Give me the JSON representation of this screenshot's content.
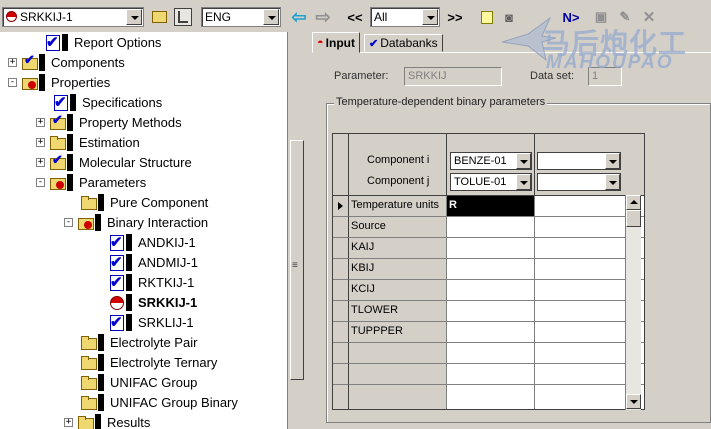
{
  "toolbar": {
    "form_selector": "SRKKIJ-1",
    "units": "ENG",
    "nav_back": "<<",
    "nav_forward": ">>",
    "filter": "All",
    "next_label": "N>"
  },
  "tree": {
    "items": [
      {
        "label": "Report Options",
        "icon": "check-icon",
        "expander": ""
      },
      {
        "label": "Components",
        "icon": "check-folder-icon",
        "expander": "+"
      },
      {
        "label": "Properties",
        "icon": "red-folder-icon",
        "expander": "-"
      },
      {
        "label": "Specifications",
        "icon": "check-icon",
        "expander": ""
      },
      {
        "label": "Property Methods",
        "icon": "check-folder-icon",
        "expander": "+"
      },
      {
        "label": "Estimation",
        "icon": "folder-icon",
        "expander": "+"
      },
      {
        "label": "Molecular Structure",
        "icon": "check-folder-icon",
        "expander": "+"
      },
      {
        "label": "Parameters",
        "icon": "red-folder-icon",
        "expander": "-"
      },
      {
        "label": "Pure Component",
        "icon": "folder-icon",
        "expander": ""
      },
      {
        "label": "Binary Interaction",
        "icon": "red-folder-icon",
        "expander": "-"
      },
      {
        "label": "ANDKIJ-1",
        "icon": "check-icon",
        "expander": ""
      },
      {
        "label": "ANDMIJ-1",
        "icon": "check-icon",
        "expander": ""
      },
      {
        "label": "RKTKIJ-1",
        "icon": "check-icon",
        "expander": ""
      },
      {
        "label": "SRKKIJ-1",
        "icon": "half-red-icon",
        "expander": ""
      },
      {
        "label": "SRKLIJ-1",
        "icon": "check-icon",
        "expander": ""
      },
      {
        "label": "Electrolyte Pair",
        "icon": "folder-icon",
        "expander": ""
      },
      {
        "label": "Electrolyte Ternary",
        "icon": "folder-icon",
        "expander": ""
      },
      {
        "label": "UNIFAC Group",
        "icon": "folder-icon",
        "expander": ""
      },
      {
        "label": "UNIFAC Group Binary",
        "icon": "folder-icon",
        "expander": ""
      },
      {
        "label": "Results",
        "icon": "folder-icon",
        "expander": "+"
      }
    ]
  },
  "tabs": [
    {
      "label": "Input",
      "active": true
    },
    {
      "label": "Databanks",
      "active": false
    }
  ],
  "form": {
    "parameter_label": "Parameter:",
    "parameter_value": "SRKKIJ",
    "dataset_label": "Data set:",
    "dataset_value": "1",
    "group_title": "Temperature-dependent binary parameters"
  },
  "grid": {
    "component_i_label": "Component  i",
    "component_j_label": "Component  j",
    "col1_component_i": "BENZE-01",
    "col1_component_j": "TOLUE-01",
    "col2_component_i": "",
    "col2_component_j": "",
    "rows": [
      {
        "label": "Temperature units",
        "col1": "R",
        "col2": ""
      },
      {
        "label": "Source",
        "col1": "",
        "col2": ""
      },
      {
        "label": "KAIJ",
        "col1": "",
        "col2": ""
      },
      {
        "label": "KBIJ",
        "col1": "",
        "col2": ""
      },
      {
        "label": "KCIJ",
        "col1": "",
        "col2": ""
      },
      {
        "label": "TLOWER",
        "col1": "",
        "col2": ""
      },
      {
        "label": "TUPPPER",
        "col1": "",
        "col2": ""
      },
      {
        "label": "",
        "col1": "",
        "col2": ""
      },
      {
        "label": "",
        "col1": "",
        "col2": ""
      },
      {
        "label": "",
        "col1": "",
        "col2": ""
      }
    ]
  },
  "watermark": {
    "cn": "马后炮化工",
    "en": "MAHOUPAO"
  }
}
